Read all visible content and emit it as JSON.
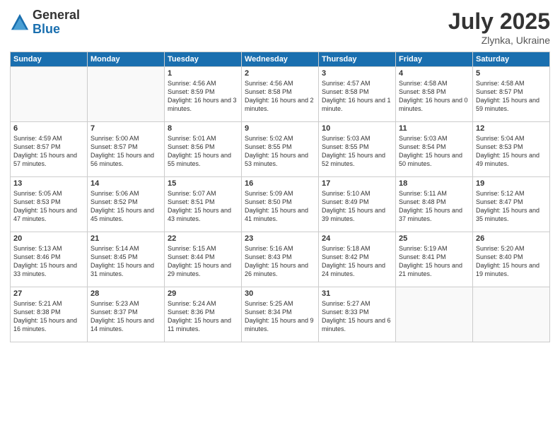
{
  "logo": {
    "general": "General",
    "blue": "Blue"
  },
  "header": {
    "month_year": "July 2025",
    "location": "Zlynka, Ukraine"
  },
  "weekdays": [
    "Sunday",
    "Monday",
    "Tuesday",
    "Wednesday",
    "Thursday",
    "Friday",
    "Saturday"
  ],
  "weeks": [
    [
      {
        "day": "",
        "text": ""
      },
      {
        "day": "",
        "text": ""
      },
      {
        "day": "1",
        "text": "Sunrise: 4:56 AM\nSunset: 8:59 PM\nDaylight: 16 hours\nand 3 minutes."
      },
      {
        "day": "2",
        "text": "Sunrise: 4:56 AM\nSunset: 8:58 PM\nDaylight: 16 hours\nand 2 minutes."
      },
      {
        "day": "3",
        "text": "Sunrise: 4:57 AM\nSunset: 8:58 PM\nDaylight: 16 hours\nand 1 minute."
      },
      {
        "day": "4",
        "text": "Sunrise: 4:58 AM\nSunset: 8:58 PM\nDaylight: 16 hours\nand 0 minutes."
      },
      {
        "day": "5",
        "text": "Sunrise: 4:58 AM\nSunset: 8:57 PM\nDaylight: 15 hours\nand 59 minutes."
      }
    ],
    [
      {
        "day": "6",
        "text": "Sunrise: 4:59 AM\nSunset: 8:57 PM\nDaylight: 15 hours\nand 57 minutes."
      },
      {
        "day": "7",
        "text": "Sunrise: 5:00 AM\nSunset: 8:57 PM\nDaylight: 15 hours\nand 56 minutes."
      },
      {
        "day": "8",
        "text": "Sunrise: 5:01 AM\nSunset: 8:56 PM\nDaylight: 15 hours\nand 55 minutes."
      },
      {
        "day": "9",
        "text": "Sunrise: 5:02 AM\nSunset: 8:55 PM\nDaylight: 15 hours\nand 53 minutes."
      },
      {
        "day": "10",
        "text": "Sunrise: 5:03 AM\nSunset: 8:55 PM\nDaylight: 15 hours\nand 52 minutes."
      },
      {
        "day": "11",
        "text": "Sunrise: 5:03 AM\nSunset: 8:54 PM\nDaylight: 15 hours\nand 50 minutes."
      },
      {
        "day": "12",
        "text": "Sunrise: 5:04 AM\nSunset: 8:53 PM\nDaylight: 15 hours\nand 49 minutes."
      }
    ],
    [
      {
        "day": "13",
        "text": "Sunrise: 5:05 AM\nSunset: 8:53 PM\nDaylight: 15 hours\nand 47 minutes."
      },
      {
        "day": "14",
        "text": "Sunrise: 5:06 AM\nSunset: 8:52 PM\nDaylight: 15 hours\nand 45 minutes."
      },
      {
        "day": "15",
        "text": "Sunrise: 5:07 AM\nSunset: 8:51 PM\nDaylight: 15 hours\nand 43 minutes."
      },
      {
        "day": "16",
        "text": "Sunrise: 5:09 AM\nSunset: 8:50 PM\nDaylight: 15 hours\nand 41 minutes."
      },
      {
        "day": "17",
        "text": "Sunrise: 5:10 AM\nSunset: 8:49 PM\nDaylight: 15 hours\nand 39 minutes."
      },
      {
        "day": "18",
        "text": "Sunrise: 5:11 AM\nSunset: 8:48 PM\nDaylight: 15 hours\nand 37 minutes."
      },
      {
        "day": "19",
        "text": "Sunrise: 5:12 AM\nSunset: 8:47 PM\nDaylight: 15 hours\nand 35 minutes."
      }
    ],
    [
      {
        "day": "20",
        "text": "Sunrise: 5:13 AM\nSunset: 8:46 PM\nDaylight: 15 hours\nand 33 minutes."
      },
      {
        "day": "21",
        "text": "Sunrise: 5:14 AM\nSunset: 8:45 PM\nDaylight: 15 hours\nand 31 minutes."
      },
      {
        "day": "22",
        "text": "Sunrise: 5:15 AM\nSunset: 8:44 PM\nDaylight: 15 hours\nand 29 minutes."
      },
      {
        "day": "23",
        "text": "Sunrise: 5:16 AM\nSunset: 8:43 PM\nDaylight: 15 hours\nand 26 minutes."
      },
      {
        "day": "24",
        "text": "Sunrise: 5:18 AM\nSunset: 8:42 PM\nDaylight: 15 hours\nand 24 minutes."
      },
      {
        "day": "25",
        "text": "Sunrise: 5:19 AM\nSunset: 8:41 PM\nDaylight: 15 hours\nand 21 minutes."
      },
      {
        "day": "26",
        "text": "Sunrise: 5:20 AM\nSunset: 8:40 PM\nDaylight: 15 hours\nand 19 minutes."
      }
    ],
    [
      {
        "day": "27",
        "text": "Sunrise: 5:21 AM\nSunset: 8:38 PM\nDaylight: 15 hours\nand 16 minutes."
      },
      {
        "day": "28",
        "text": "Sunrise: 5:23 AM\nSunset: 8:37 PM\nDaylight: 15 hours\nand 14 minutes."
      },
      {
        "day": "29",
        "text": "Sunrise: 5:24 AM\nSunset: 8:36 PM\nDaylight: 15 hours\nand 11 minutes."
      },
      {
        "day": "30",
        "text": "Sunrise: 5:25 AM\nSunset: 8:34 PM\nDaylight: 15 hours\nand 9 minutes."
      },
      {
        "day": "31",
        "text": "Sunrise: 5:27 AM\nSunset: 8:33 PM\nDaylight: 15 hours\nand 6 minutes."
      },
      {
        "day": "",
        "text": ""
      },
      {
        "day": "",
        "text": ""
      }
    ]
  ]
}
